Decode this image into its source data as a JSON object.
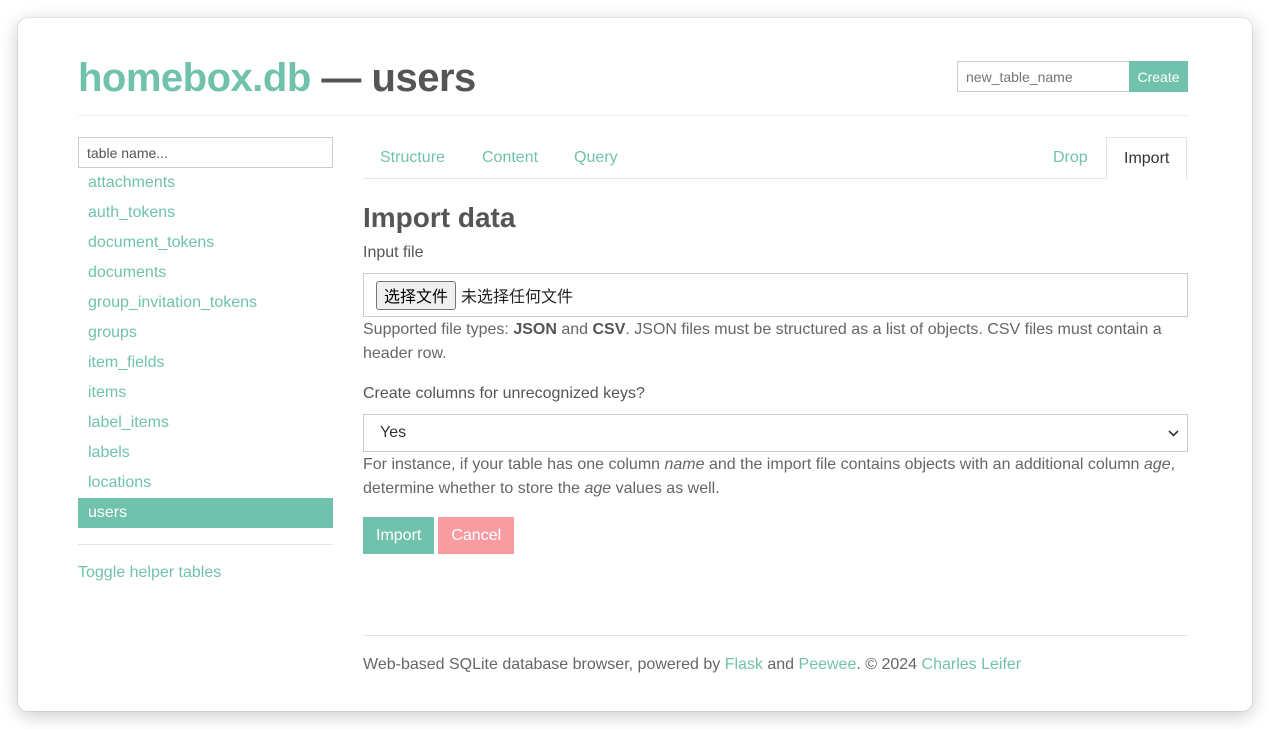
{
  "header": {
    "brand": "homebox.db",
    "separator": "—",
    "table_name": "users",
    "new_table_placeholder": "new_table_name",
    "create_label": "Create"
  },
  "sidebar": {
    "filter_placeholder": "table name...",
    "tables": [
      {
        "label": "attachments",
        "active": false
      },
      {
        "label": "auth_tokens",
        "active": false
      },
      {
        "label": "document_tokens",
        "active": false
      },
      {
        "label": "documents",
        "active": false
      },
      {
        "label": "group_invitation_tokens",
        "active": false
      },
      {
        "label": "groups",
        "active": false
      },
      {
        "label": "item_fields",
        "active": false
      },
      {
        "label": "items",
        "active": false
      },
      {
        "label": "label_items",
        "active": false
      },
      {
        "label": "labels",
        "active": false
      },
      {
        "label": "locations",
        "active": false
      },
      {
        "label": "users",
        "active": true
      }
    ],
    "toggle_label": "Toggle helper tables"
  },
  "tabs": {
    "structure": "Structure",
    "content": "Content",
    "query": "Query",
    "drop": "Drop",
    "import": "Import",
    "active": "Import"
  },
  "import_form": {
    "title": "Import data",
    "file_label": "Input file",
    "file_button": "选择文件",
    "file_status": "未选择任何文件",
    "file_help": {
      "prefix": "Supported file types: ",
      "type1": "JSON",
      "and": " and ",
      "type2": "CSV",
      "suffix": ". JSON files must be structured as a list of objects. CSV files must contain a header row."
    },
    "columns_label": "Create columns for unrecognized keys?",
    "columns_value": "Yes",
    "columns_help": {
      "p1": "For instance, if your table has one column ",
      "name_word": "name",
      "p2": " and the import file contains objects with an additional column ",
      "age_word": "age",
      "p3": ", determine whether to store the ",
      "age_word2": "age",
      "p4": " values as well."
    },
    "import_label": "Import",
    "cancel_label": "Cancel"
  },
  "footer": {
    "text1": "Web-based SQLite database browser, powered by ",
    "flask": "Flask",
    "and": " and ",
    "peewee": "Peewee",
    "text2": ". © 2024 ",
    "author": "Charles Leifer"
  },
  "colors": {
    "accent": "#70c2ad",
    "danger": "#f99ca1",
    "text": "#555555"
  }
}
